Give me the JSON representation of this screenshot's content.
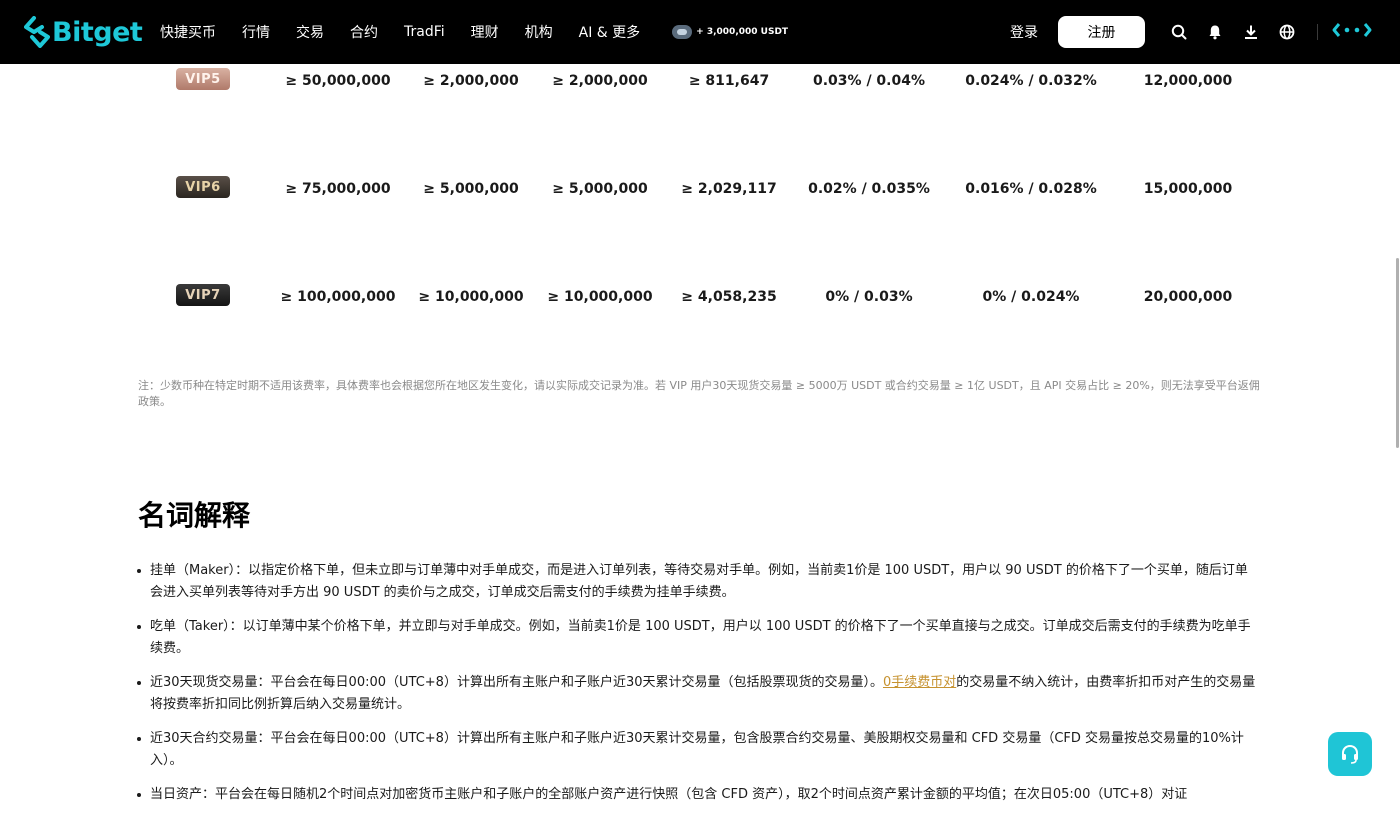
{
  "nav": {
    "brand": "Bitget",
    "items": [
      "快捷买币",
      "行情",
      "交易",
      "合约",
      "TradFi",
      "理财",
      "机构",
      "AI & 更多"
    ],
    "promo": "+ 3,000,000 USDT",
    "login": "登录",
    "register": "注册",
    "icons": [
      "search-icon",
      "bell-icon",
      "download-icon",
      "globe-icon",
      "brand-glyph-icon"
    ]
  },
  "vip_rows": [
    {
      "level": "VIP5",
      "c1": "≥ 50,000,000",
      "c2": "≥ 2,000,000",
      "c3": "≥ 2,000,000",
      "c4": "≥ 811,647",
      "c5": "0.03% / 0.04%",
      "c6": "0.024% / 0.032%",
      "c7": "12,000,000"
    },
    {
      "level": "VIP6",
      "c1": "≥ 75,000,000",
      "c2": "≥ 5,000,000",
      "c3": "≥ 5,000,000",
      "c4": "≥ 2,029,117",
      "c5": "0.02% / 0.035%",
      "c6": "0.016% / 0.028%",
      "c7": "15,000,000"
    },
    {
      "level": "VIP7",
      "c1": "≥ 100,000,000",
      "c2": "≥ 10,000,000",
      "c3": "≥ 10,000,000",
      "c4": "≥ 4,058,235",
      "c5": "0% / 0.03%",
      "c6": "0% / 0.024%",
      "c7": "20,000,000"
    }
  ],
  "note": "注：少数币种在特定时期不适用该费率，具体费率也会根据您所在地区发生变化，请以实际成交记录为准。若 VIP 用户30天现货交易量 ≥ 5000万 USDT 或合约交易量 ≥ 1亿 USDT，且 API 交易占比 ≥ 20%，则无法享受平台返佣政策。",
  "terms": {
    "title": "名词解释",
    "items": [
      {
        "text": "挂单（Maker）：以指定价格下单，但未立即与订单薄中对手单成交，而是进入订单列表，等待交易对手单。例如，当前卖1价是 100 USDT，用户以 90 USDT 的价格下了一个买单，随后订单会进入买单列表等待对手方出 90 USDT 的卖价与之成交，订单成交后需支付的手续费为挂单手续费。"
      },
      {
        "text": "吃单（Taker）：以订单薄中某个价格下单，并立即与对手单成交。例如，当前卖1价是 100 USDT，用户以 100 USDT 的价格下了一个买单直接与之成交。订单成交后需支付的手续费为吃单手续费。"
      },
      {
        "pre": "近30天现货交易量：平台会在每日00:00（UTC+8）计算出所有主账户和子账户近30天累计交易量（包括股票现货的交易量）。",
        "link": "0手续费币对",
        "post": "的交易量不纳入统计，由费率折扣币对产生的交易量将按费率折扣同比例折算后纳入交易量统计。"
      },
      {
        "text": "近30天合约交易量：平台会在每日00:00（UTC+8）计算出所有主账户和子账户近30天累计交易量，包含股票合约交易量、美股期权交易量和 CFD 交易量（CFD 交易量按总交易量的10%计入）。"
      },
      {
        "text": "当日资产：平台会在每日随机2个时间点对加密货币主账户和子账户的全部账户资产进行快照（包含 CFD 资产），取2个时间点资产累计金额的平均值；在次日05:00（UTC+8）对证"
      }
    ]
  },
  "colors": {
    "brand": "#1ec8d8",
    "support": "#1fc5d6",
    "link": "#c6922f"
  }
}
